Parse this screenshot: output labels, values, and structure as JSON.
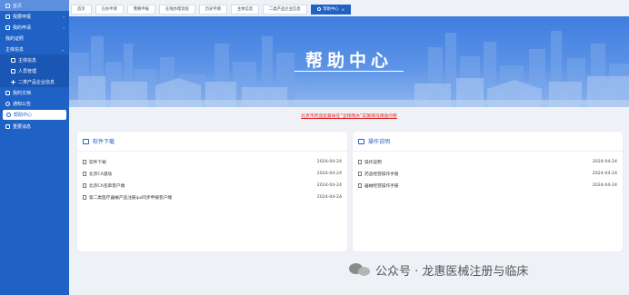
{
  "sidebar": {
    "top_label": "首页",
    "items": [
      {
        "label": "我要申报",
        "arrow": "›"
      },
      {
        "label": "我的申请",
        "arrow": "›"
      },
      {
        "label": "我的证照",
        "arrow": ""
      },
      {
        "label": "主体信息",
        "arrow": "⌄"
      },
      {
        "label": "主体信息",
        "arrow": ""
      },
      {
        "label": "人员管理",
        "arrow": ""
      },
      {
        "label": "二类产品企业信息",
        "arrow": ""
      },
      {
        "label": "我的文档",
        "arrow": ""
      },
      {
        "label": "通知公告",
        "arrow": ""
      },
      {
        "label": "帮助中心",
        "arrow": ""
      },
      {
        "label": "重要消息",
        "arrow": ""
      }
    ]
  },
  "tabs": [
    {
      "label": "首页"
    },
    {
      "label": "在办申请"
    },
    {
      "label": "我要申报"
    },
    {
      "label": "在线办理流程"
    },
    {
      "label": "历史申请"
    },
    {
      "label": "主体信息"
    },
    {
      "label": "二类产品企业信息"
    },
    {
      "label": "帮助中心",
      "close": "×"
    }
  ],
  "banner": {
    "title": "帮助中心"
  },
  "notice": "北京市药品监督局在“全程网办”实施情况调查问卷",
  "software": {
    "title": "软件下载",
    "items": [
      {
        "name": "软件下载",
        "date": "2024-04-24"
      },
      {
        "name": "北京CA驱动",
        "date": "2024-04-24"
      },
      {
        "name": "北京CA签章客户端",
        "date": "2024-04-24"
      },
      {
        "name": "第二类医疗器械产品注册ips同步申报客户端",
        "date": "2024-04-24"
      }
    ]
  },
  "manual": {
    "title": "操作说明",
    "items": [
      {
        "name": "操作说明",
        "date": "2024-04-24"
      },
      {
        "name": "药品经营操作手册",
        "date": "2024-04-24"
      },
      {
        "name": "器械经营操作手册",
        "date": "2024-04-24"
      }
    ]
  },
  "watermark": {
    "text": "公众号 · 龙惠医械注册与临床"
  },
  "colors": {
    "primary": "#1f61c4",
    "notice": "#e02020",
    "banner_top": "#3f7de0",
    "banner_bottom": "#8fb6ef"
  }
}
